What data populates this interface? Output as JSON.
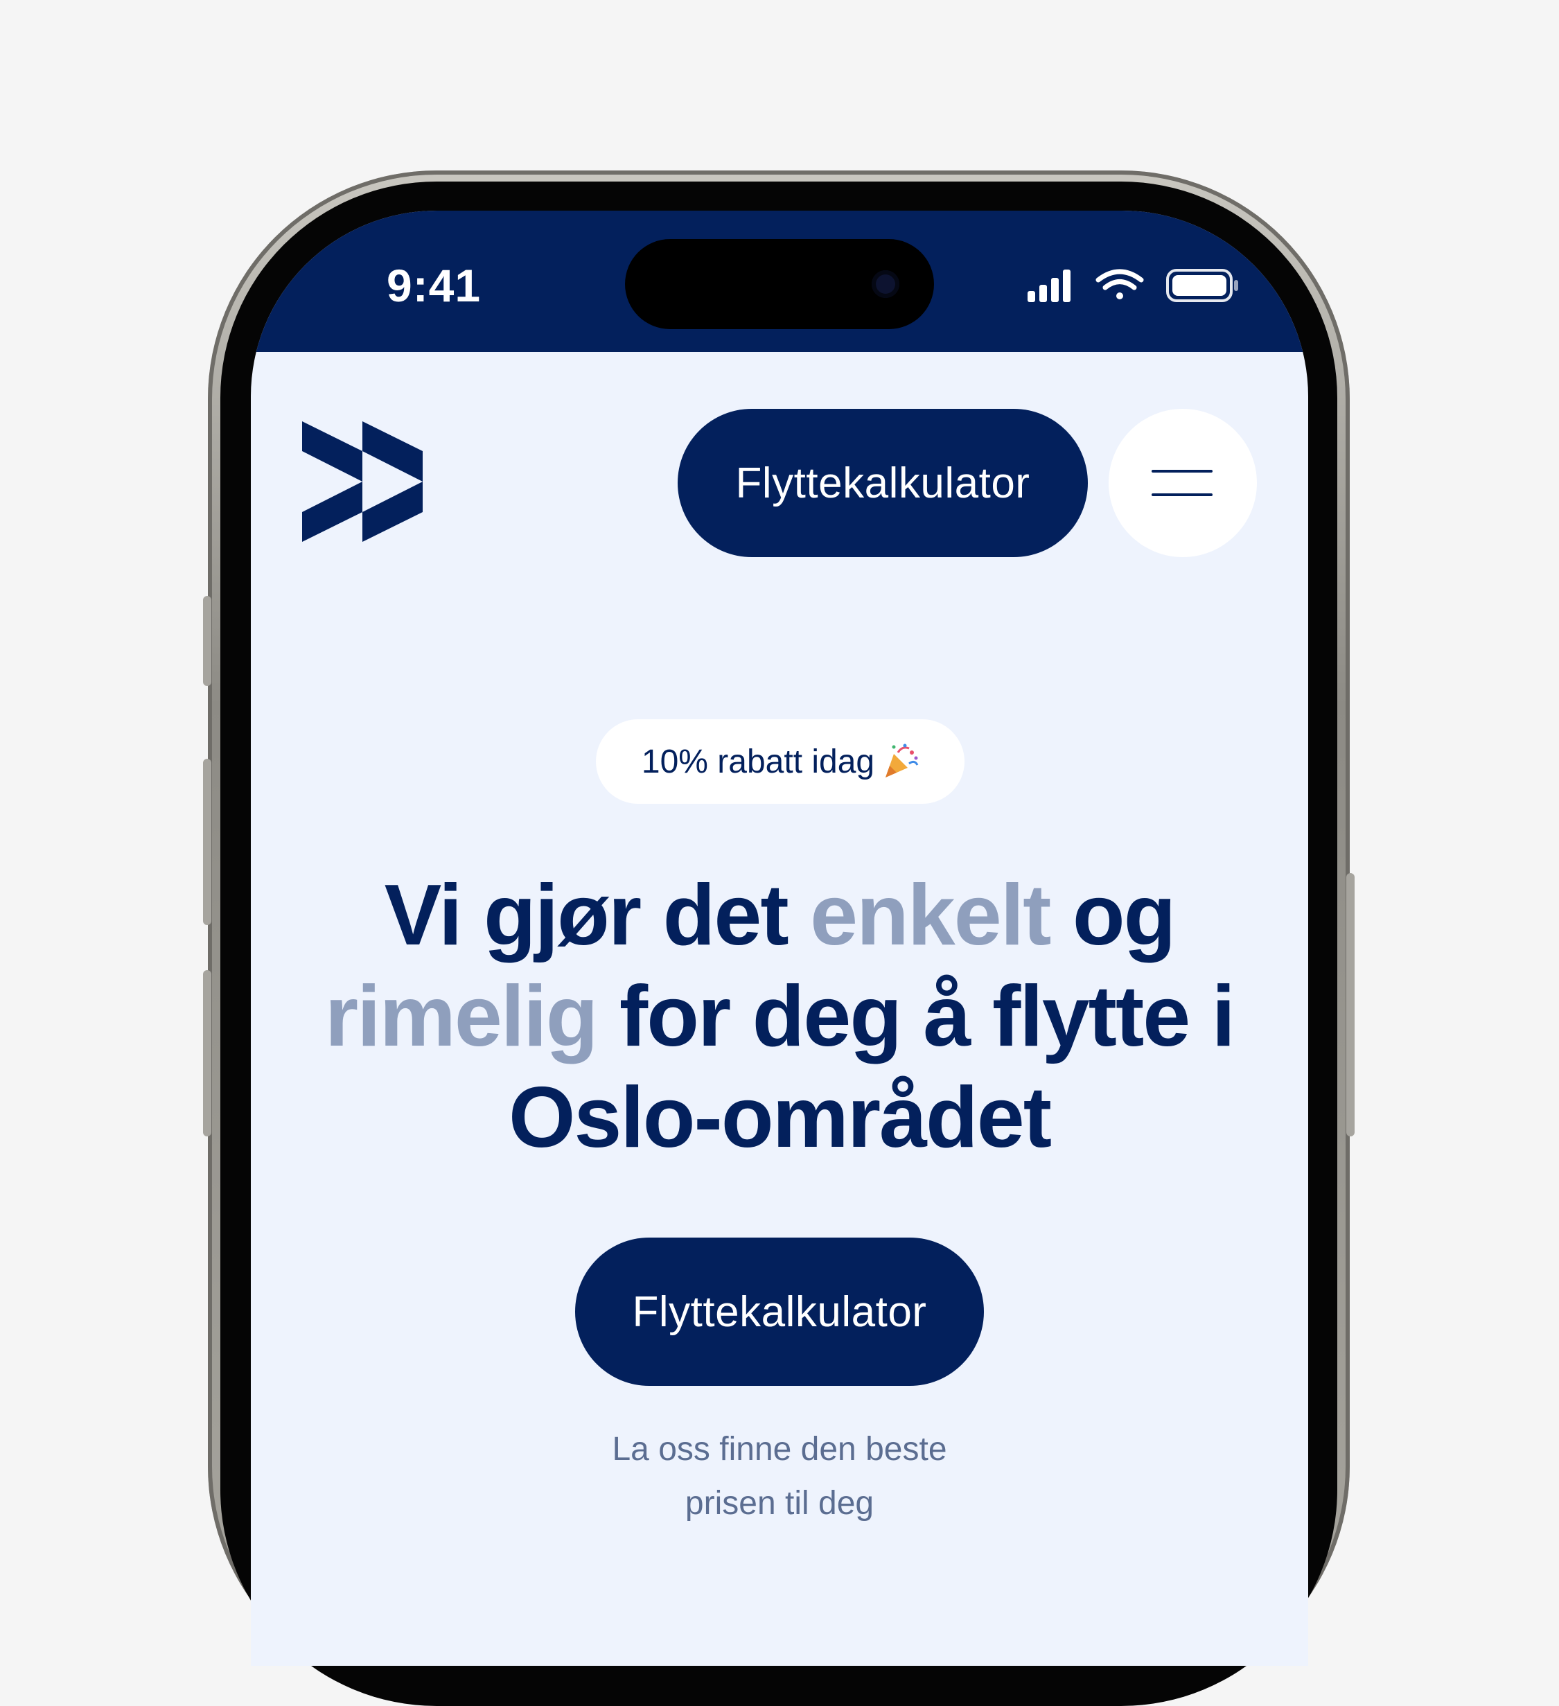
{
  "status_bar": {
    "time": "9:41"
  },
  "header": {
    "cta_label": "Flyttekalkulator",
    "menu_icon": "hamburger-menu-icon"
  },
  "promo": {
    "text": "10% rabatt idag",
    "icon": "party-popper-icon"
  },
  "hero": {
    "headline_part1": "Vi gjør det ",
    "headline_highlight1": "enkelt",
    "headline_part2": " og ",
    "headline_highlight2": "rimelig",
    "headline_part3": " for deg å flytte i Oslo-området",
    "cta_label": "Flyttekalkulator",
    "subtext": "La oss finne den beste prisen til deg"
  },
  "colors": {
    "brand_navy": "#03205c",
    "page_bg": "#eef3fd",
    "muted_text": "#8f9fbd",
    "subtext": "#5b6d91"
  }
}
